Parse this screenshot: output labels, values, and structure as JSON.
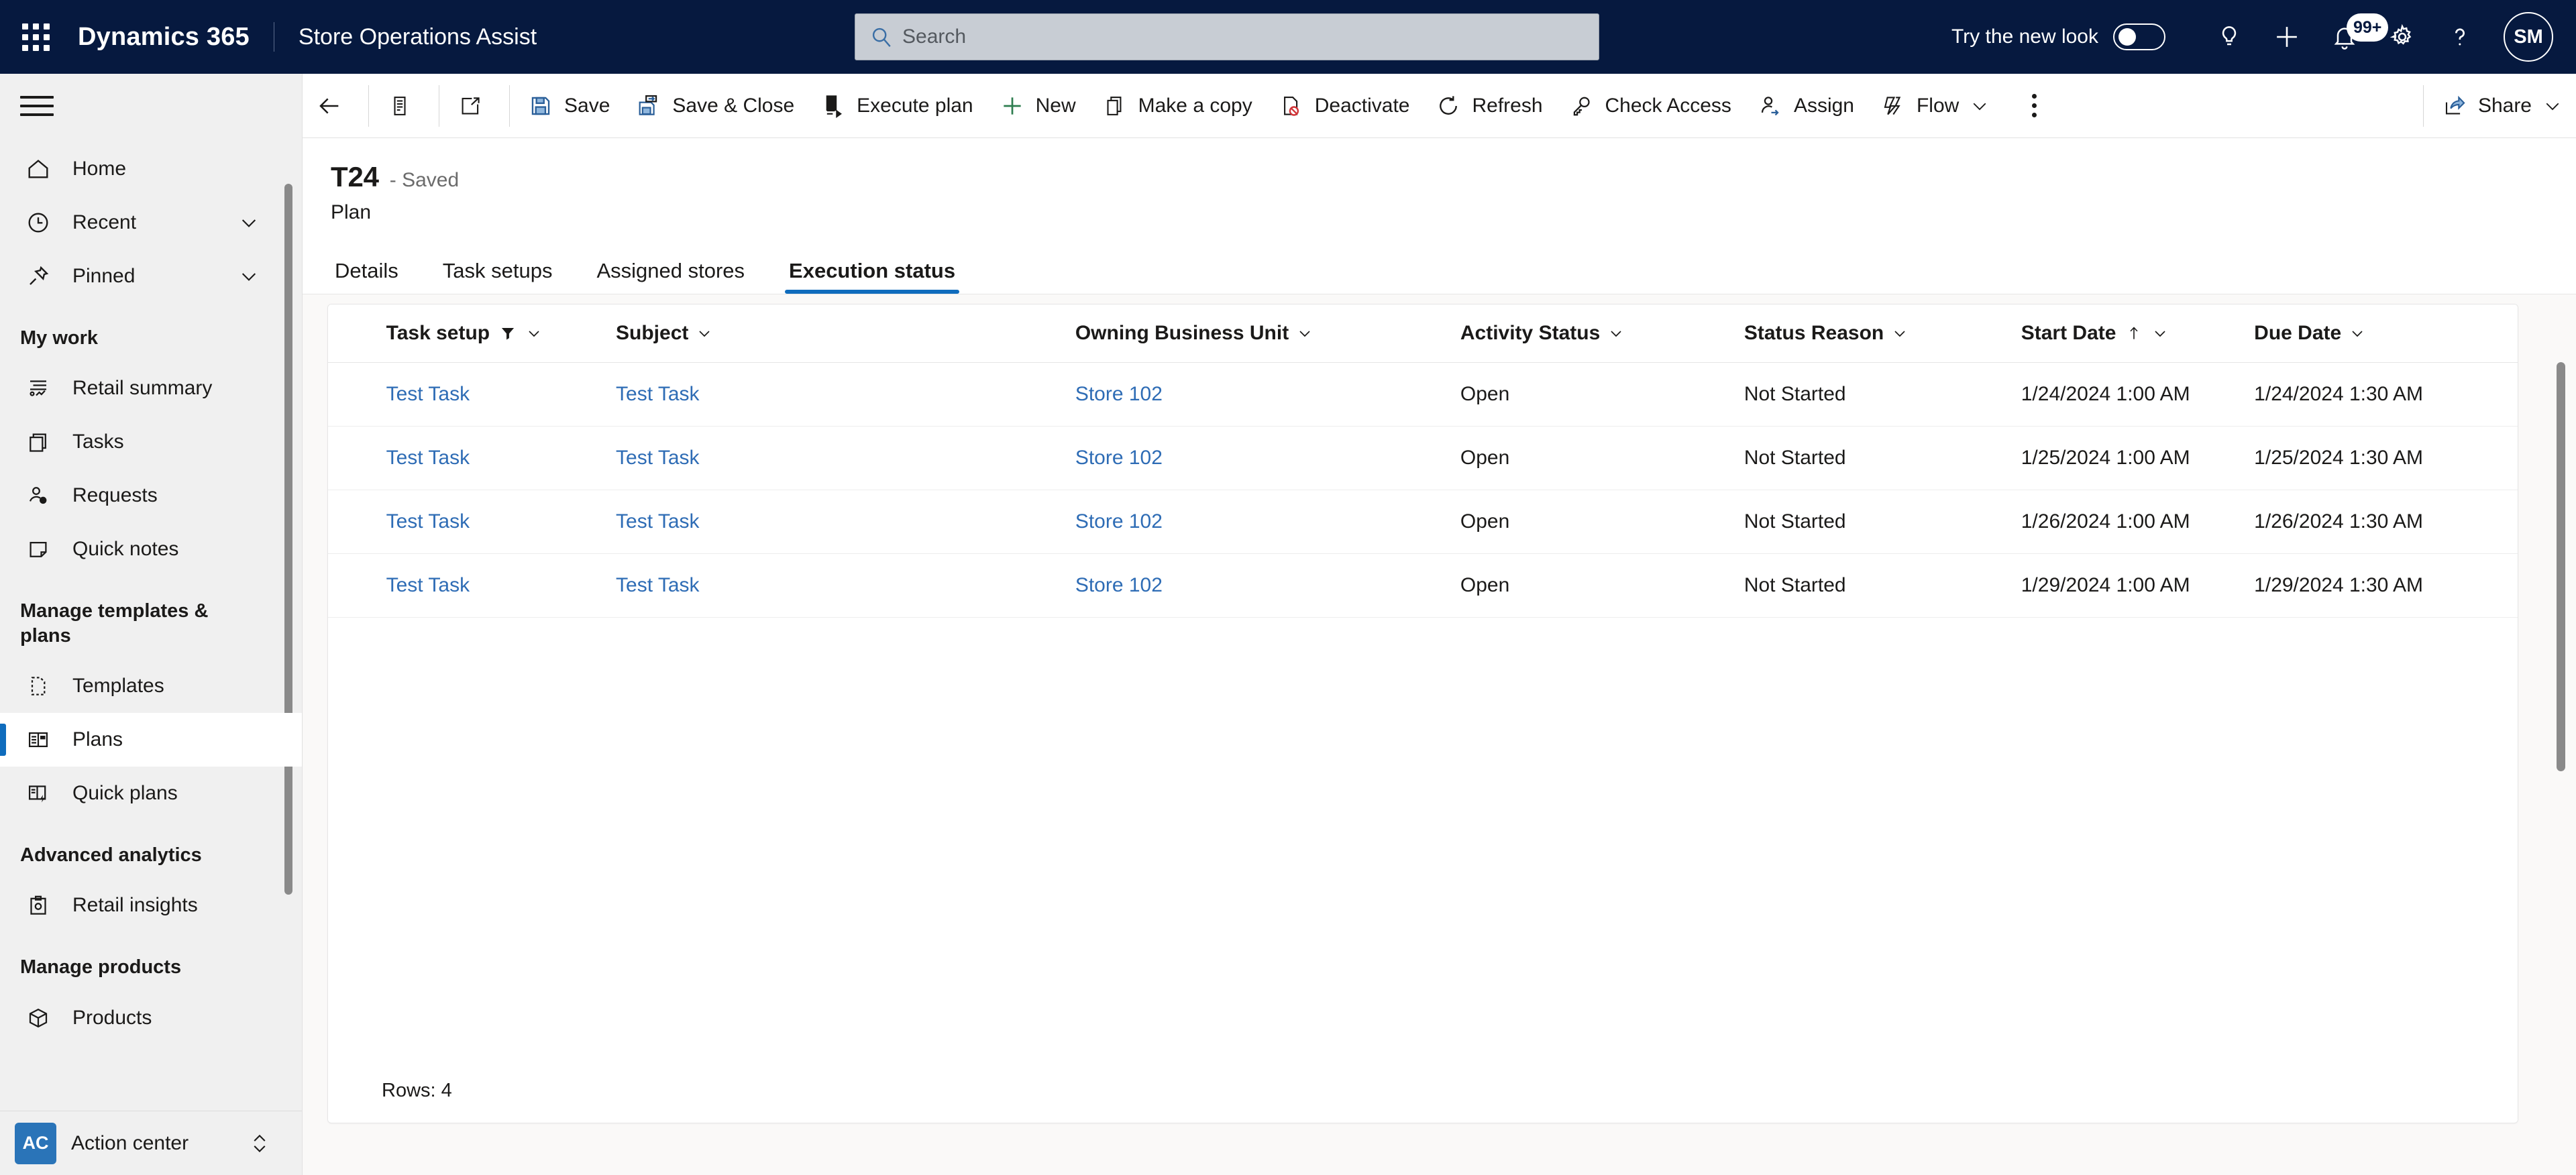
{
  "header": {
    "waffle_label": "app-launcher",
    "brand": "Dynamics 365",
    "app_name": "Store Operations Assist",
    "search_placeholder": "Search",
    "new_look_label": "Try the new look",
    "notifications_badge": "99+",
    "avatar_initials": "SM",
    "accent_dark": "#06193f"
  },
  "sidebar": {
    "primary": [
      {
        "label": "Home",
        "icon": "home-icon",
        "chevron": false
      },
      {
        "label": "Recent",
        "icon": "clock-icon",
        "chevron": true
      },
      {
        "label": "Pinned",
        "icon": "pin-icon",
        "chevron": true
      }
    ],
    "groups": [
      {
        "title": "My work",
        "items": [
          {
            "label": "Retail summary",
            "icon": "analytics-icon"
          },
          {
            "label": "Tasks",
            "icon": "tasks-icon"
          },
          {
            "label": "Requests",
            "icon": "requests-icon"
          },
          {
            "label": "Quick notes",
            "icon": "note-icon"
          }
        ]
      },
      {
        "title": "Manage templates & plans",
        "items": [
          {
            "label": "Templates",
            "icon": "template-icon"
          },
          {
            "label": "Plans",
            "icon": "plans-icon",
            "selected": true
          },
          {
            "label": "Quick plans",
            "icon": "quick-plans-icon"
          }
        ]
      },
      {
        "title": "Advanced analytics",
        "items": [
          {
            "label": "Retail insights",
            "icon": "insights-icon"
          }
        ]
      },
      {
        "title": "Manage products",
        "items": [
          {
            "label": "Products",
            "icon": "product-box-icon"
          }
        ]
      }
    ],
    "action_center": {
      "badge": "AC",
      "label": "Action center"
    }
  },
  "commandbar": {
    "back": "back-arrow",
    "form_selector": "form-selector",
    "popout": "pop-out",
    "items": [
      {
        "label": "Save",
        "icon": "save-icon"
      },
      {
        "label": "Save & Close",
        "icon": "save-close-icon"
      },
      {
        "label": "Execute plan",
        "icon": "execute-plan-icon"
      },
      {
        "label": "New",
        "icon": "plus-icon"
      },
      {
        "label": "Make a copy",
        "icon": "copy-icon"
      },
      {
        "label": "Deactivate",
        "icon": "deactivate-icon"
      },
      {
        "label": "Refresh",
        "icon": "refresh-icon"
      },
      {
        "label": "Check Access",
        "icon": "key-icon"
      },
      {
        "label": "Assign",
        "icon": "assign-icon"
      },
      {
        "label": "Flow",
        "icon": "flow-icon",
        "chevron": true
      }
    ],
    "overflow": "more-commands",
    "share": {
      "label": "Share",
      "icon": "share-icon",
      "chevron": true
    }
  },
  "record": {
    "title": "T24",
    "saved_state": "- Saved",
    "entity": "Plan"
  },
  "tabs": [
    {
      "label": "Details",
      "active": false
    },
    {
      "label": "Task setups",
      "active": false
    },
    {
      "label": "Assigned stores",
      "active": false
    },
    {
      "label": "Execution status",
      "active": true
    }
  ],
  "grid": {
    "columns": [
      {
        "label": "Task setup",
        "filtered": true,
        "sort": ""
      },
      {
        "label": "Subject",
        "filtered": false,
        "sort": ""
      },
      {
        "label": "Owning Business Unit",
        "filtered": false,
        "sort": ""
      },
      {
        "label": "Activity Status",
        "filtered": false,
        "sort": ""
      },
      {
        "label": "Status Reason",
        "filtered": false,
        "sort": ""
      },
      {
        "label": "Start Date",
        "filtered": false,
        "sort": "asc"
      },
      {
        "label": "Due Date",
        "filtered": false,
        "sort": ""
      }
    ],
    "rows": [
      {
        "task_setup": "Test Task",
        "subject": "Test Task",
        "owning_business_unit": "Store 102",
        "activity_status": "Open",
        "status_reason": "Not Started",
        "start_date": "1/24/2024 1:00 AM",
        "due_date": "1/24/2024 1:30 AM"
      },
      {
        "task_setup": "Test Task",
        "subject": "Test Task",
        "owning_business_unit": "Store 102",
        "activity_status": "Open",
        "status_reason": "Not Started",
        "start_date": "1/25/2024 1:00 AM",
        "due_date": "1/25/2024 1:30 AM"
      },
      {
        "task_setup": "Test Task",
        "subject": "Test Task",
        "owning_business_unit": "Store 102",
        "activity_status": "Open",
        "status_reason": "Not Started",
        "start_date": "1/26/2024 1:00 AM",
        "due_date": "1/26/2024 1:30 AM"
      },
      {
        "task_setup": "Test Task",
        "subject": "Test Task",
        "owning_business_unit": "Store 102",
        "activity_status": "Open",
        "status_reason": "Not Started",
        "start_date": "1/29/2024 1:00 AM",
        "due_date": "1/29/2024 1:30 AM"
      }
    ],
    "footer": "Rows: 4"
  },
  "colors": {
    "link": "#2e6cb5",
    "accent": "#0f6cbd",
    "header_bg": "#06193f"
  }
}
